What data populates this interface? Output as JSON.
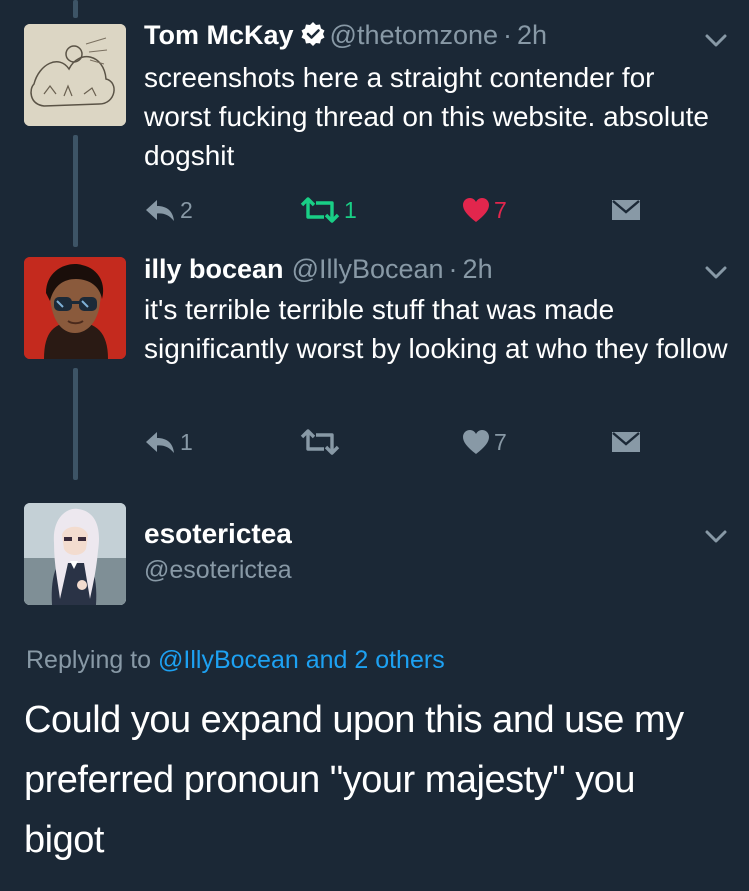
{
  "tweets": [
    {
      "name": "Tom McKay",
      "handle": "@thetomzone",
      "dot": "·",
      "time": "2h",
      "text": "screenshots here a straight contender for worst fucking thread on this website. absolute dogshit",
      "replies": "2",
      "retweets": "1",
      "likes": "7",
      "verified": true,
      "retweeted": true,
      "liked": true,
      "icons": [
        "reply-icon",
        "retweet-icon",
        "heart-icon",
        "dm-envelope-icon",
        "chevron-down-icon",
        "verified-badge-icon"
      ]
    },
    {
      "name": "illy bocean",
      "handle": "@IllyBocean",
      "dot": "·",
      "time": "2h",
      "text": "it's terrible terrible stuff that was made significantly worst by looking at who they follow",
      "replies": "1",
      "retweets": "",
      "likes": "7",
      "verified": false,
      "retweeted": false,
      "liked": false
    }
  ],
  "main_tweet": {
    "name": "esoterictea",
    "handle": "@esoterictea",
    "replying_prefix": "Replying to",
    "replying_to": "@IllyBocean and 2 others",
    "text": "Could you expand upon this and use my preferred pronoun \"your majesty\" you bigot"
  },
  "colors": {
    "background": "#1b2836",
    "muted": "#8899a6",
    "link": "#1da1f2",
    "retweet_active": "#19cf86",
    "like_active": "#e2264d"
  }
}
